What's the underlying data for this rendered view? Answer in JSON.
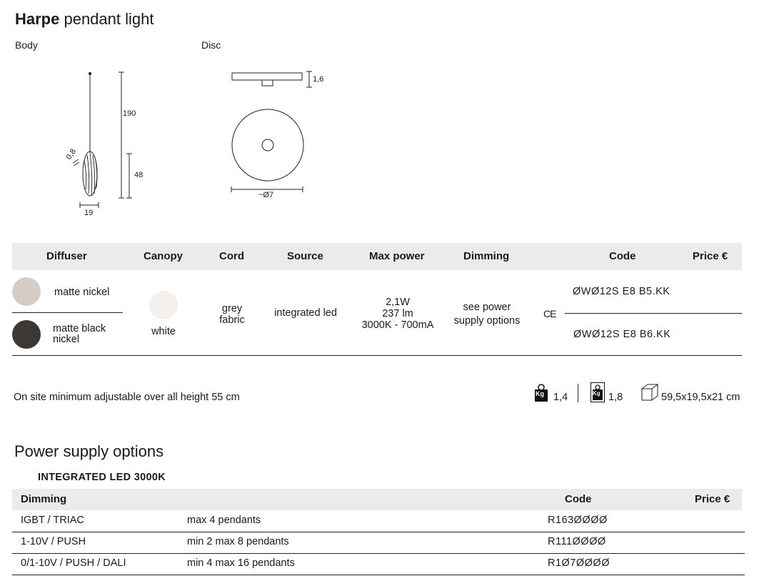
{
  "title": {
    "bold": "Harpe",
    "rest": " pendant light"
  },
  "drawings": {
    "body_label": "Body",
    "disc_label": "Disc",
    "body_dims": {
      "height": "190",
      "diffuser_height": "48",
      "width": "19",
      "cord": "0,8"
    },
    "disc_dims": {
      "thickness": "1,6",
      "diameter": "~Ø7"
    }
  },
  "spec_table": {
    "headers": {
      "diffuser": "Diffuser",
      "canopy": "Canopy",
      "cord": "Cord",
      "source": "Source",
      "max_power": "Max power",
      "dimming": "Dimming",
      "code": "Code",
      "price": "Price €"
    },
    "diffusers": [
      {
        "name": "matte nickel",
        "color": "#d3cdc6"
      },
      {
        "name_line1": "matte black",
        "name_line2": "nickel",
        "color": "#3d3836"
      }
    ],
    "canopy": {
      "name": "white",
      "color": "#f4f1ec"
    },
    "cord": {
      "line1": "grey",
      "line2": "fabric"
    },
    "source": "integrated led",
    "max_power": {
      "line1": "2,1W",
      "line2": "237 lm",
      "line3": "3000K - 700mA"
    },
    "dimming": {
      "line1": "see power",
      "line2": "supply options"
    },
    "ce_mark": "CE",
    "codes": [
      "ØWØ12S E8 B5.KK",
      "ØWØ12S E8 B6.KK"
    ]
  },
  "footer": {
    "note": "On site minimum adjustable over all height 55 cm",
    "net_weight": "1,4",
    "gross_weight": "1,8",
    "package_size": "59,5x19,5x21 cm",
    "kg_label": "Kg"
  },
  "power_supply": {
    "title": "Power supply options",
    "subtitle": "INTEGRATED LED 3000K",
    "headers": {
      "dimming": "Dimming",
      "code": "Code",
      "price": "Price €"
    },
    "rows": [
      {
        "dimming": "IGBT / TRIAC",
        "desc": "max 4 pendants",
        "code": "R163ØØØØ"
      },
      {
        "dimming": "1-10V / PUSH",
        "desc": "min 2 max 8 pendants",
        "code": "R111ØØØØ"
      },
      {
        "dimming": "0/1-10V / PUSH / DALI",
        "desc": "min 4 max 16 pendants",
        "code": "R1Ø7ØØØØ"
      }
    ]
  }
}
